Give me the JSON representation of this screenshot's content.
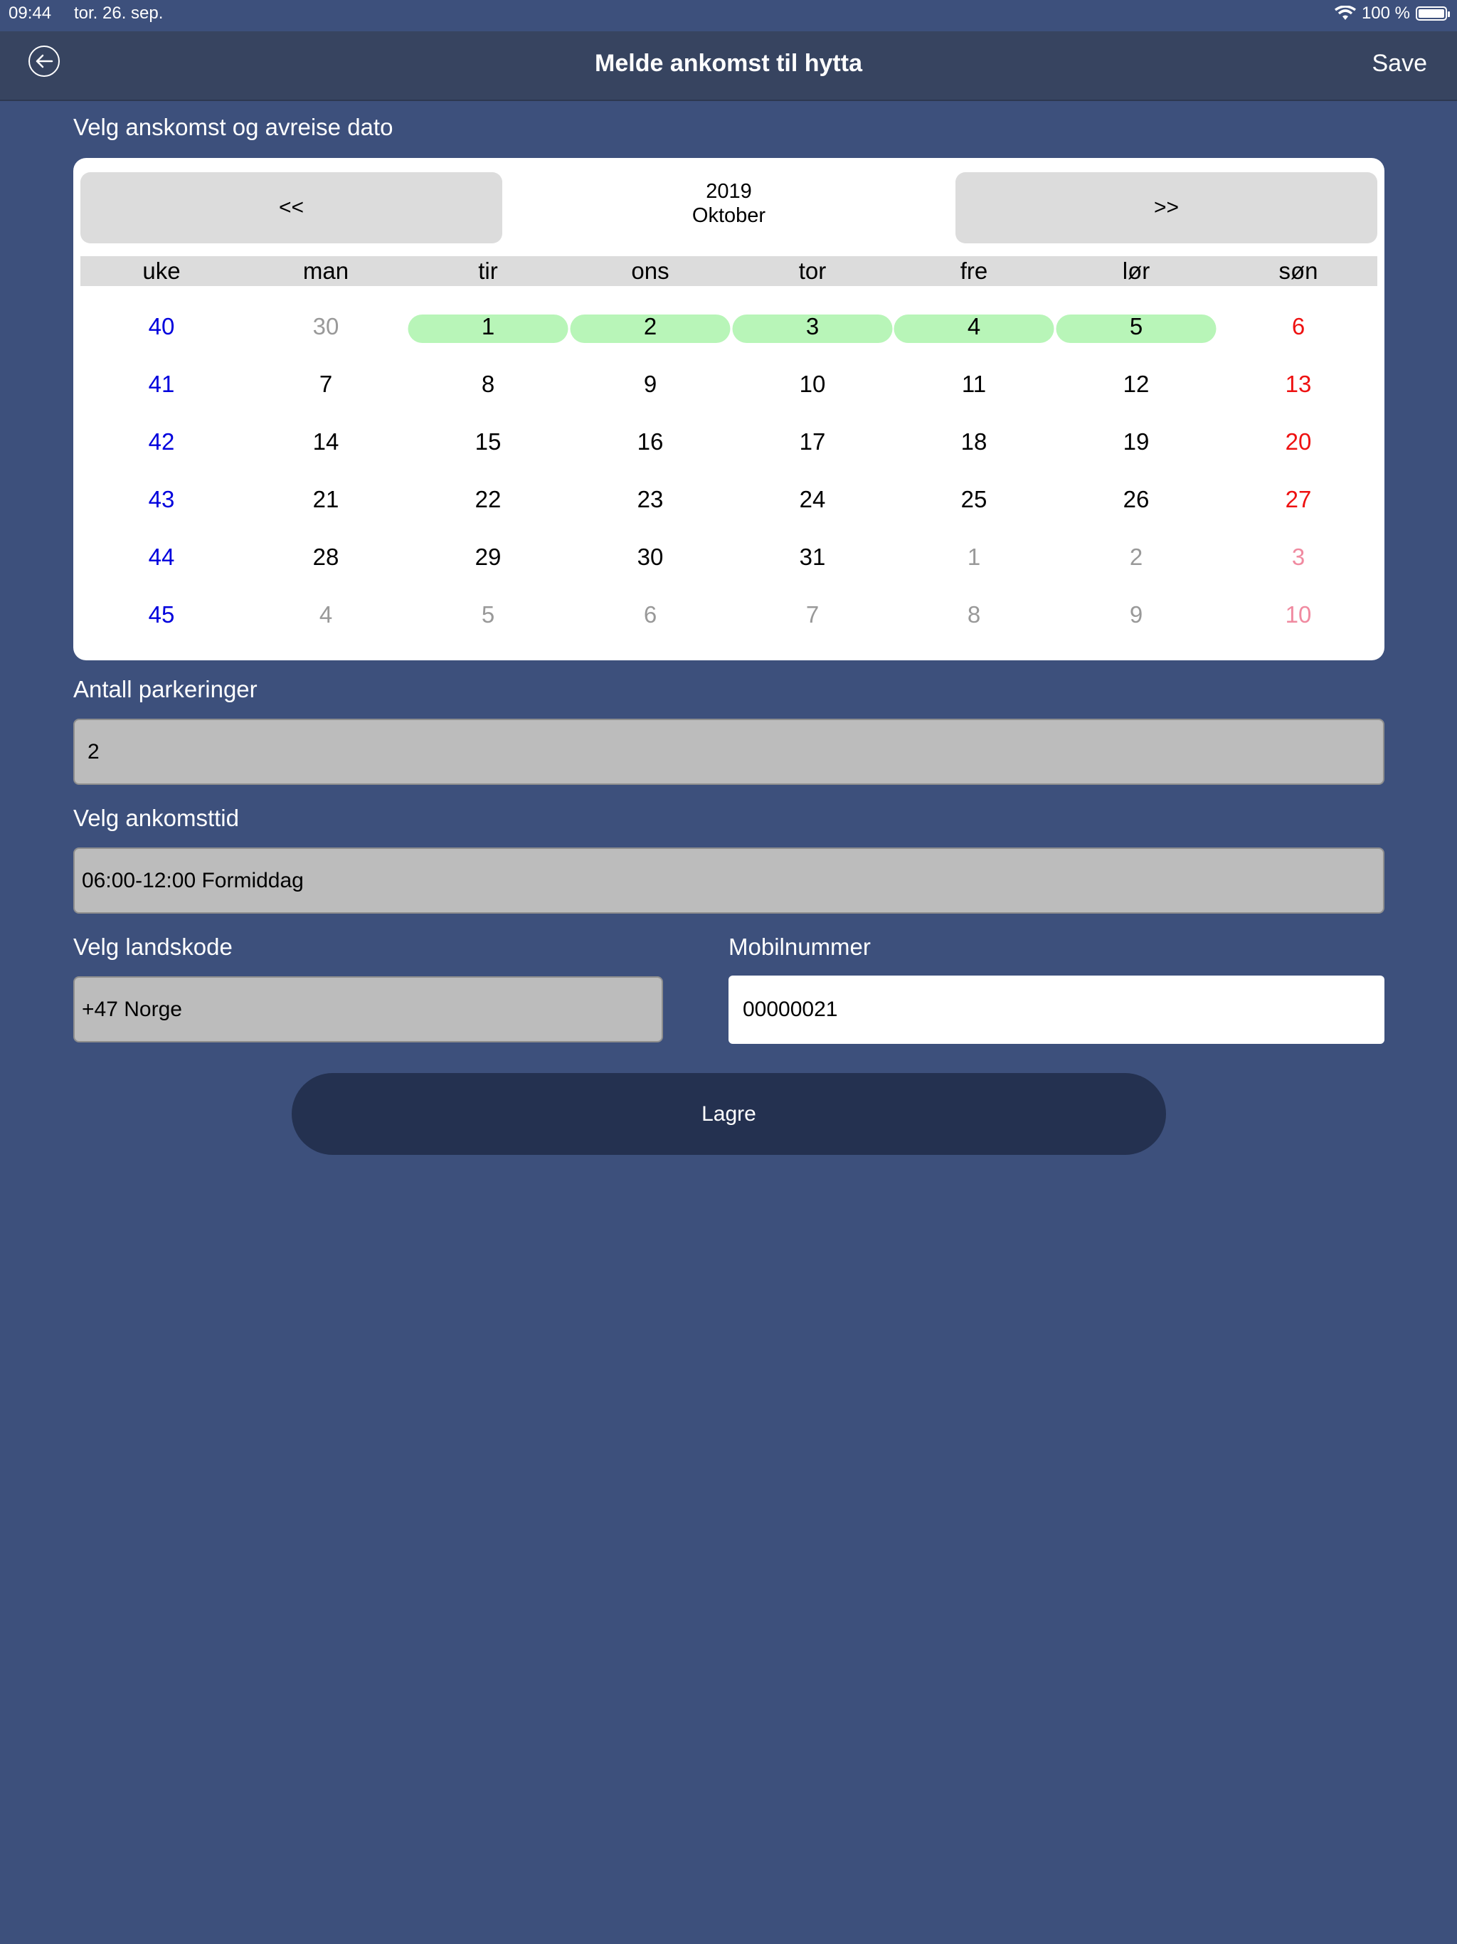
{
  "status_bar": {
    "time": "09:44",
    "date": "tor. 26. sep.",
    "battery": "100 %"
  },
  "nav": {
    "title": "Melde ankomst til hytta",
    "save": "Save"
  },
  "calendar": {
    "section_label": "Velg anskomst og avreise dato",
    "prev": "<<",
    "next": ">>",
    "year": "2019",
    "month": "Oktober",
    "weekdays": [
      "uke",
      "man",
      "tir",
      "ons",
      "tor",
      "fre",
      "lør",
      "søn"
    ],
    "weeks": [
      {
        "week": "40",
        "days": [
          "30",
          "1",
          "2",
          "3",
          "4",
          "5",
          "6"
        ]
      },
      {
        "week": "41",
        "days": [
          "7",
          "8",
          "9",
          "10",
          "11",
          "12",
          "13"
        ]
      },
      {
        "week": "42",
        "days": [
          "14",
          "15",
          "16",
          "17",
          "18",
          "19",
          "20"
        ]
      },
      {
        "week": "43",
        "days": [
          "21",
          "22",
          "23",
          "24",
          "25",
          "26",
          "27"
        ]
      },
      {
        "week": "44",
        "days": [
          "28",
          "29",
          "30",
          "31",
          "1",
          "2",
          "3"
        ]
      },
      {
        "week": "45",
        "days": [
          "4",
          "5",
          "6",
          "7",
          "8",
          "9",
          "10"
        ]
      }
    ],
    "selected_days": [
      "1",
      "2",
      "3",
      "4",
      "5"
    ],
    "colors": {
      "week": "#0000dd",
      "weekday": "#000000",
      "sunday": "#ee1111",
      "other_month": "#999999",
      "other_month_sunday": "#f08aa0",
      "selected_bg": "#b8f5b8"
    }
  },
  "parking": {
    "label": "Antall parkeringer",
    "value": "2"
  },
  "arrival_time": {
    "label": "Velg ankomsttid",
    "value": "06:00-12:00 Formiddag"
  },
  "country_code": {
    "label": "Velg landskode",
    "value": "+47 Norge"
  },
  "mobile": {
    "label": "Mobilnummer",
    "value": "00000021"
  },
  "save_button": "Lagre"
}
